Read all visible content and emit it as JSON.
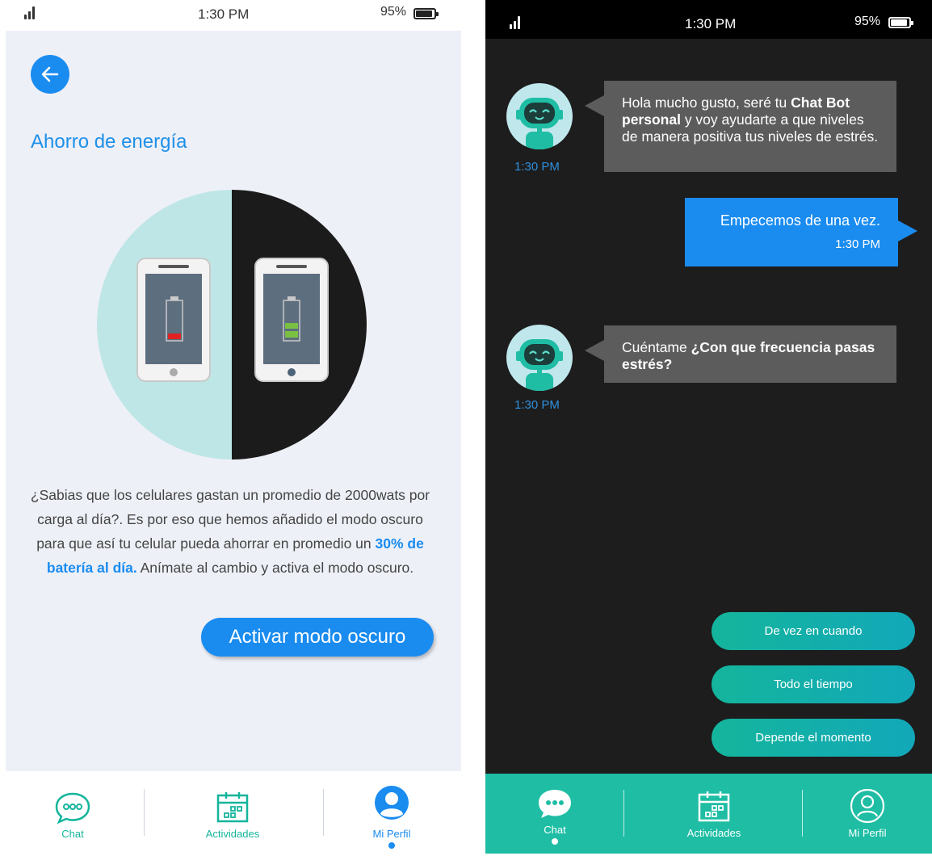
{
  "left": {
    "status": {
      "time": "1:30 PM",
      "battery": "95%"
    },
    "title": "Ahorro de energía",
    "info_text_1": "¿Sabias que los celulares gastan un promedio de 2000wats por carga al día?. Es por eso que hemos añadido el modo oscuro para que así tu celular pueda ahorrar en promedio un ",
    "info_highlight": "30% de batería al día.",
    "info_text_2": " Anímate al cambio y activa el modo oscuro.",
    "activate_button": "Activar modo oscuro",
    "tabs": [
      {
        "label": "Chat",
        "icon": "chat-bubble-icon"
      },
      {
        "label": "Actividades",
        "icon": "calendar-icon"
      },
      {
        "label": "Mi Perfil",
        "icon": "user-profile-icon"
      }
    ],
    "accent": "#1a8cf0",
    "tab_color": "#14b59c"
  },
  "right": {
    "status": {
      "time": "1:30 PM",
      "battery": "95%"
    },
    "messages": [
      {
        "from": "bot",
        "pre": "Hola mucho gusto, seré tu ",
        "bold": "Chat Bot personal",
        "post": " y voy ayudarte a que niveles de manera positiva tus niveles de estrés.",
        "time": "1:30 PM"
      },
      {
        "from": "user",
        "text": "Empecemos de una vez.",
        "time": "1:30 PM"
      },
      {
        "from": "bot",
        "pre": "Cuéntame ",
        "bold": "¿Con que frecuencia pasas estrés?",
        "post": "",
        "time": "1:30 PM"
      }
    ],
    "options": [
      "De vez en cuando",
      "Todo el tiempo",
      "Depende el momento"
    ],
    "tabs": [
      {
        "label": "Chat",
        "icon": "chat-bubble-icon"
      },
      {
        "label": "Actividades",
        "icon": "calendar-icon"
      },
      {
        "label": "Mi Perfil",
        "icon": "user-profile-icon"
      }
    ],
    "tabbar_color": "#1ebda4"
  }
}
